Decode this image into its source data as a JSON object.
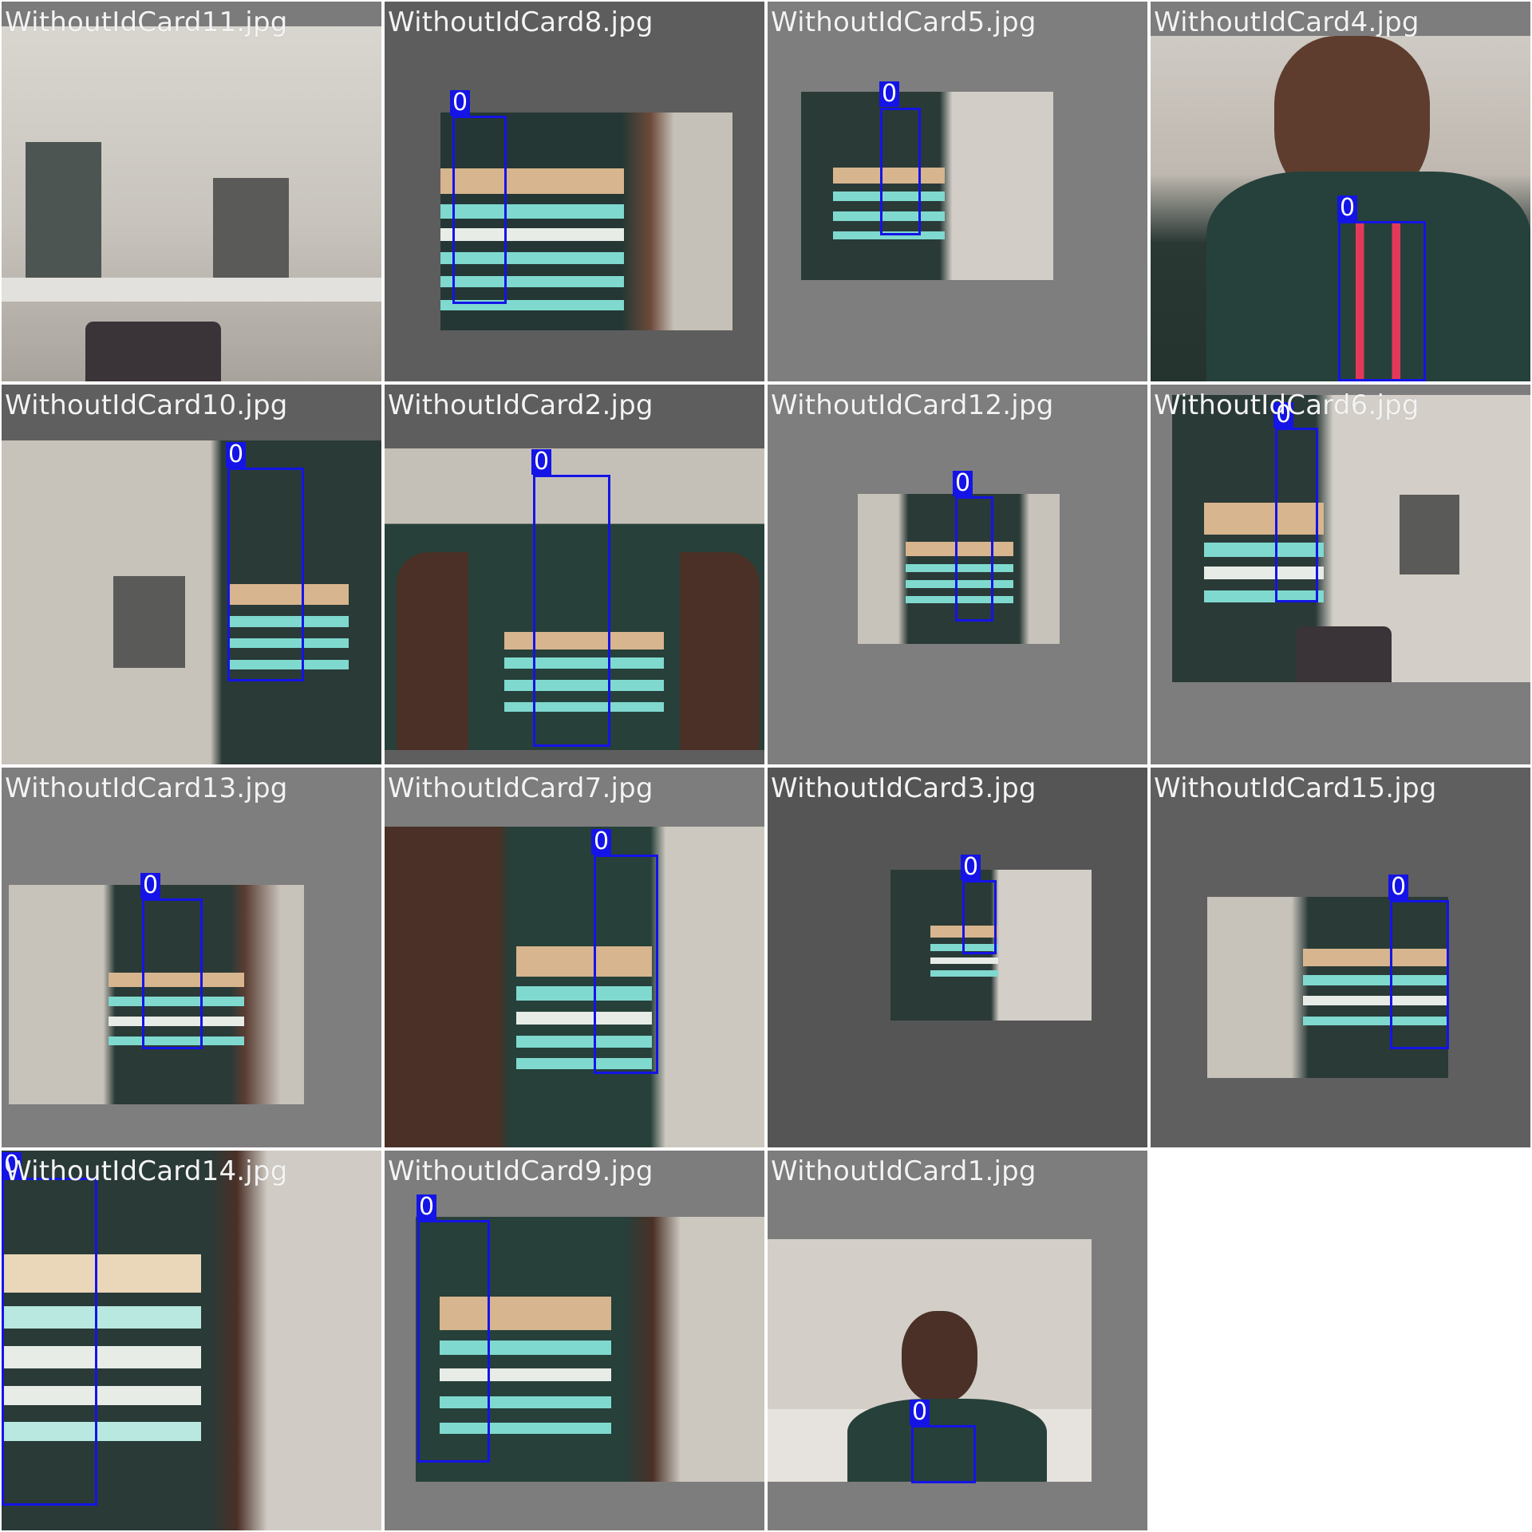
{
  "grid": {
    "columns": 4,
    "rows": 4,
    "tiles": [
      {
        "filename": "WithoutIdCard11.jpg",
        "boxes": []
      },
      {
        "filename": "WithoutIdCard8.jpg",
        "boxes": [
          {
            "label": "0"
          }
        ]
      },
      {
        "filename": "WithoutIdCard5.jpg",
        "boxes": [
          {
            "label": "0"
          }
        ]
      },
      {
        "filename": "WithoutIdCard4.jpg",
        "boxes": [
          {
            "label": "0"
          }
        ]
      },
      {
        "filename": "WithoutIdCard10.jpg",
        "boxes": [
          {
            "label": "0"
          }
        ]
      },
      {
        "filename": "WithoutIdCard2.jpg",
        "boxes": [
          {
            "label": "0"
          }
        ]
      },
      {
        "filename": "WithoutIdCard12.jpg",
        "boxes": [
          {
            "label": "0"
          }
        ]
      },
      {
        "filename": "WithoutIdCard6.jpg",
        "boxes": [
          {
            "label": "0"
          }
        ]
      },
      {
        "filename": "WithoutIdCard13.jpg",
        "boxes": [
          {
            "label": "0"
          }
        ]
      },
      {
        "filename": "WithoutIdCard7.jpg",
        "boxes": [
          {
            "label": "0"
          }
        ]
      },
      {
        "filename": "WithoutIdCard3.jpg",
        "boxes": [
          {
            "label": "0"
          }
        ]
      },
      {
        "filename": "WithoutIdCard15.jpg",
        "boxes": [
          {
            "label": "0"
          }
        ]
      },
      {
        "filename": "WithoutIdCard14.jpg",
        "boxes": [
          {
            "label": "0"
          }
        ]
      },
      {
        "filename": "WithoutIdCard9.jpg",
        "boxes": [
          {
            "label": "0"
          }
        ]
      },
      {
        "filename": "WithoutIdCard1.jpg",
        "boxes": [
          {
            "label": "0"
          }
        ]
      }
    ]
  },
  "colors": {
    "box_stroke": "#1414e6",
    "label_text": "#ffffff",
    "filename_text": "#f3f3f3",
    "page_background": "#ffffff"
  }
}
